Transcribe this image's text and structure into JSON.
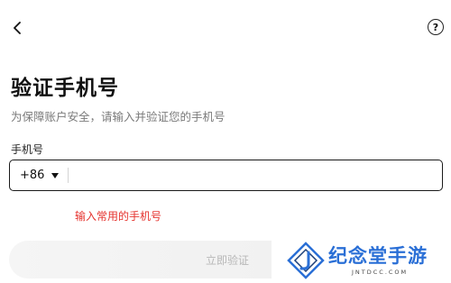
{
  "header": {
    "back_icon": "chevron-left-icon",
    "help_icon": "question-circle-icon",
    "help_glyph": "?"
  },
  "main": {
    "title": "验证手机号",
    "subtitle": "为保障账户安全，请输入并验证您的手机号",
    "phone_label": "手机号",
    "country_code": "+86",
    "phone_value": "",
    "error_message": "输入常用的手机号",
    "verify_button": "立即验证"
  },
  "watermark": {
    "brand": "纪念堂手游",
    "domain": "JNTDCC.COM"
  },
  "colors": {
    "error": "#e5322d",
    "watermark_blue": "#2a6fd6"
  }
}
